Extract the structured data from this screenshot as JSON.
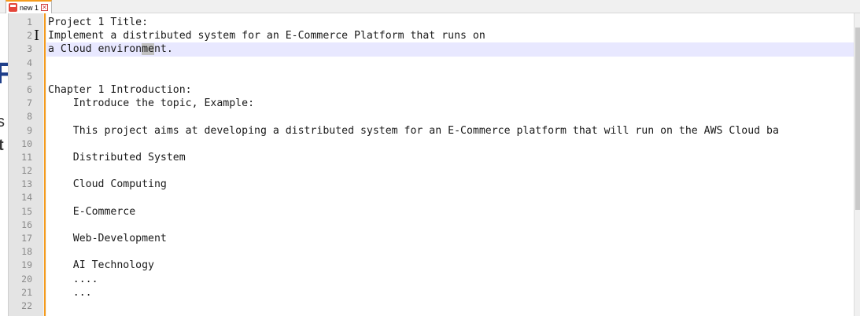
{
  "tab": {
    "label": "new 1",
    "close_glyph": "✕",
    "save_icon": "disk-icon",
    "accent": "#f59b1c"
  },
  "background": {
    "glyphs": [
      "F",
      "s",
      "t"
    ]
  },
  "editor": {
    "current_line": 3,
    "selected_text": "me",
    "lines": [
      {
        "n": "1",
        "text": "Project 1 Title:"
      },
      {
        "n": "2",
        "text": "Implement a distributed system for an E-Commerce Platform that runs on"
      },
      {
        "n": "3",
        "pre": "a Cloud environ",
        "sel": "me",
        "post": "nt."
      },
      {
        "n": "4",
        "text": ""
      },
      {
        "n": "5",
        "text": ""
      },
      {
        "n": "6",
        "text": "Chapter 1 Introduction:"
      },
      {
        "n": "7",
        "text": "    Introduce the topic, Example:"
      },
      {
        "n": "8",
        "text": ""
      },
      {
        "n": "9",
        "text": "    This project aims at developing a distributed system for an E-Commerce platform that will run on the AWS Cloud ba"
      },
      {
        "n": "10",
        "text": ""
      },
      {
        "n": "11",
        "text": "    Distributed System"
      },
      {
        "n": "12",
        "text": ""
      },
      {
        "n": "13",
        "text": "    Cloud Computing"
      },
      {
        "n": "14",
        "text": ""
      },
      {
        "n": "15",
        "text": "    E-Commerce"
      },
      {
        "n": "16",
        "text": ""
      },
      {
        "n": "17",
        "text": "    Web-Development"
      },
      {
        "n": "18",
        "text": ""
      },
      {
        "n": "19",
        "text": "    AI Technology"
      },
      {
        "n": "20",
        "text": "    ...."
      },
      {
        "n": "21",
        "text": "    ..."
      },
      {
        "n": "22",
        "text": ""
      }
    ]
  },
  "cursor_glyph": "I"
}
